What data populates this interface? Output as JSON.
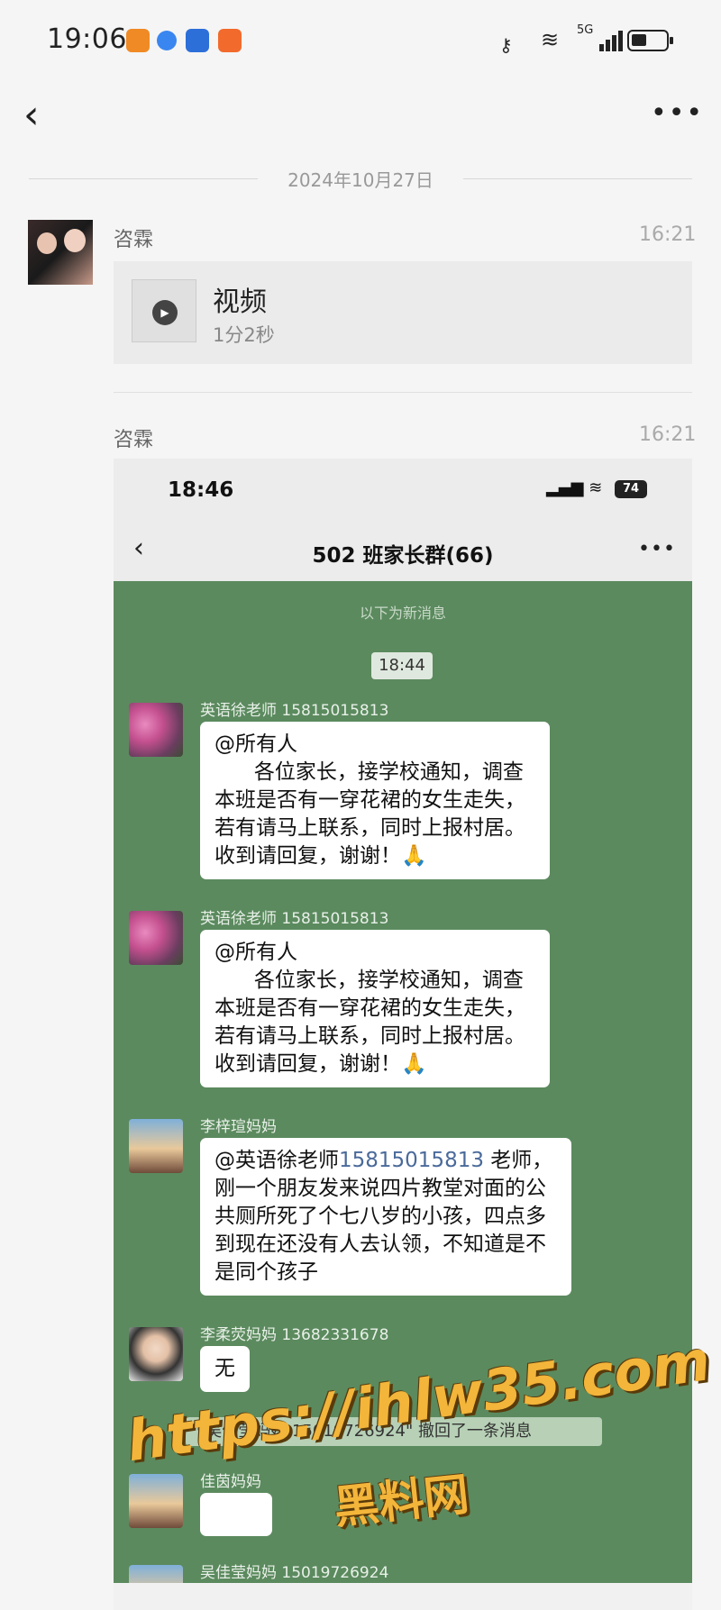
{
  "status_bar": {
    "time": "19:06",
    "network": "5G"
  },
  "nav": {
    "back": "‹",
    "more": "•••"
  },
  "date_separator": "2024年10月27日",
  "entries": [
    {
      "sender": "咨霖",
      "time": "16:21",
      "video_title": "视频",
      "video_duration": "1分2秒"
    },
    {
      "sender": "咨霖",
      "time": "16:21"
    }
  ],
  "screenshot": {
    "time": "18:46",
    "battery": "74",
    "back": "‹",
    "title": "502 班家长群(66)",
    "more": "•••",
    "new_messages": "以下为新消息",
    "time_pill": "18:44",
    "messages": [
      {
        "name": "英语徐老师 15815015813",
        "text": "@所有人\n      各位家长，接学校通知，调查本班是否有一穿花裙的女生走失，若有请马上联系，同时上报村居。收到请回复，谢谢！🙏"
      },
      {
        "name": "英语徐老师 15815015813",
        "text": "@所有人\n      各位家长，接学校通知，调查本班是否有一穿花裙的女生走失，若有请马上联系，同时上报村居。收到请回复，谢谢！🙏"
      },
      {
        "name": "李梓瑄妈妈",
        "mention": "@英语徐老师",
        "phone": "15815015813",
        "text": " 老师，刚一个朋友发来说四片教堂对面的公共厕所死了个七八岁的小孩，四点多到现在还没有人去认领，不知道是不是同个孩子"
      },
      {
        "name": "李柔荧妈妈 13682331678",
        "text": "无"
      }
    ],
    "recall": "\"吴佳莹妈妈 15019726924\" 撤回了一条消息",
    "msg5_name": "佳茵妈妈",
    "msg6_name": "吴佳莹妈妈 15019726924"
  },
  "watermark": {
    "url": "https://ihlw35.com",
    "name": "黑料网"
  }
}
